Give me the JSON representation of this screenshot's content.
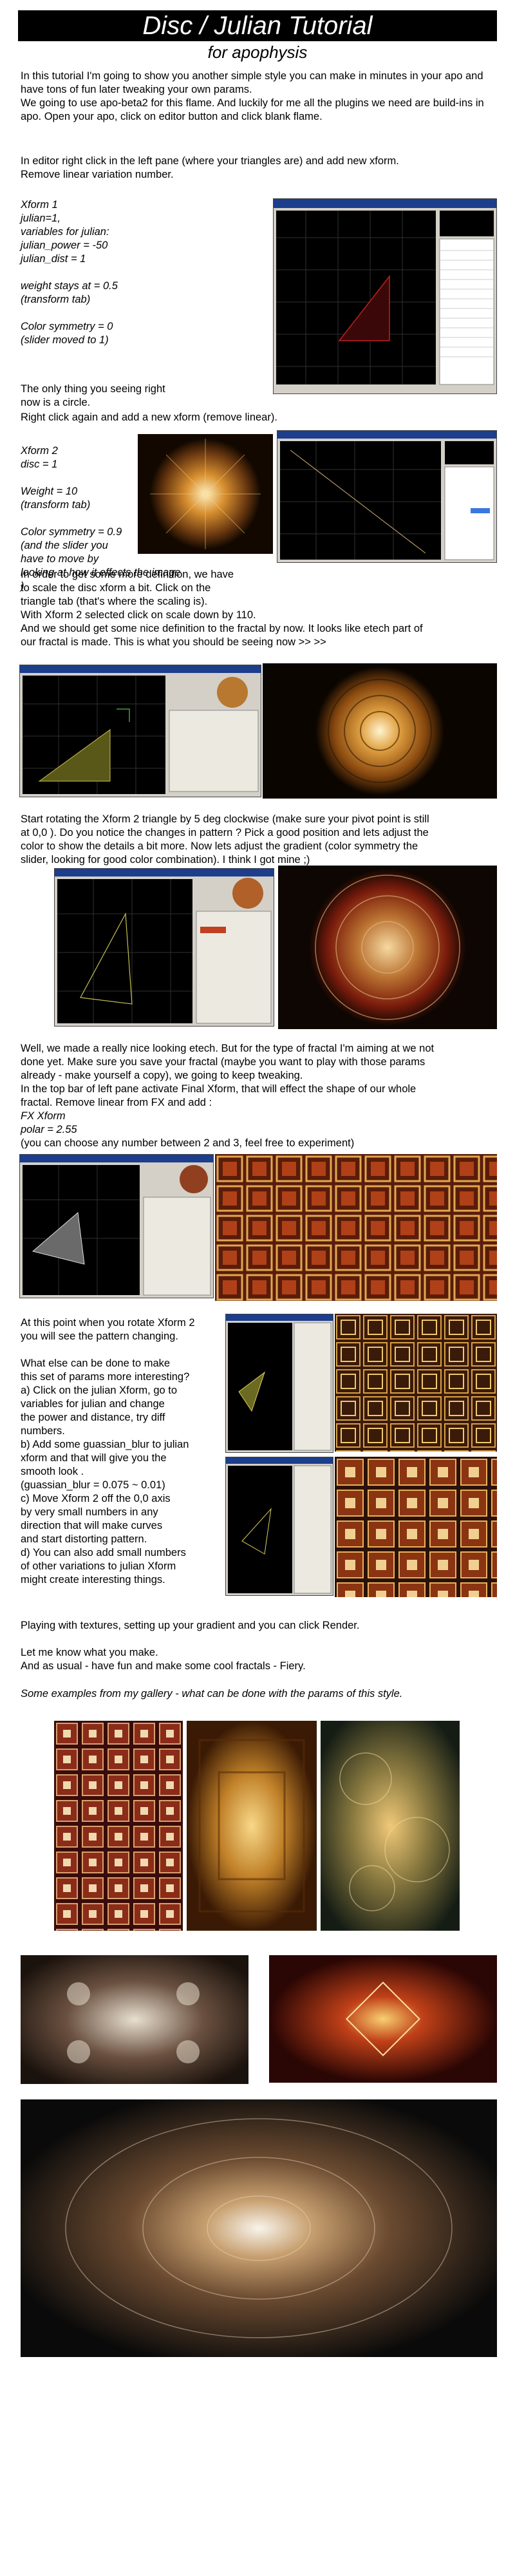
{
  "header": {
    "title": "Disc / Julian Tutorial",
    "subtitle": "for apophysis"
  },
  "intro": "In this tutorial I'm going to show you another simple style you can make in minutes in your apo and have tons of fun later tweaking your own params.\nWe going to use apo-beta2 for this flame. And luckily for me all the plugins we need are build-ins in apo. Open your apo, click on editor button and click blank flame.",
  "step1": {
    "text": "In editor right click in the left pane (where your triangles are) and add new xform.\nRemove linear variation number.",
    "xform1": "Xform 1\njulian=1,\nvariables  for julian:\njulian_power = -50\njulian_dist = 1\n\nweight stays at = 0.5\n(transform tab)\n\nColor symmetry = 0\n(slider moved to 1)",
    "circle_note": "The only thing you seeing right\nnow is a circle."
  },
  "step2": {
    "text": "Right click again and add a new xform (remove linear).",
    "xform2": "Xform 2\ndisc = 1\n\nWeight = 10\n(transform tab)\n\nColor symmetry = 0.9\n(and the slider you\nhave to move by\nlooking at how it effects the image )"
  },
  "step3": {
    "text": "In order to get some more definition, we have\nto scale the disc xform a bit. Click on the\ntriangle tab (that's where the scaling is).\nWith Xform 2 selected click on scale down by 110.\nAnd we should get some nice  definition to the fractal by now.  It looks like etech part of\nour fractal is made. This is what you should be seeing now >>  >>"
  },
  "step4": {
    "text": "Start rotating the Xform 2 triangle by 5 deg clockwise (make sure your pivot point is still\nat 0,0 ).  Do you notice the changes in pattern ? Pick a good position and lets adjust the\ncolor to show the details a bit more. Now lets adjust the gradient (color symmetry the\nslider, looking for good color combination). I think I got mine ;)"
  },
  "step5": {
    "text": "Well, we made a really nice looking etech. But for the type of fractal I'm aiming at we not\ndone yet. Make sure you save your fractal (maybe you want to play with those params\nalready - make yourself a copy), we going to keep tweaking.\nIn the top bar of left pane activate Final Xform, that will effect the shape of our whole\nfractal. Remove linear from FX and add :",
    "fx": "FX Xform\npolar = 2.55",
    "fx_note": "(you can choose any number between 2 and 3, feel free to experiment)"
  },
  "step6": {
    "text": "At this point when you rotate Xform 2\nyou will see the pattern changing.\n\nWhat else can be done to make\nthis set of params more interesting?\na) Click on the julian Xform, go to\n    variables for julian and  change\n    the power and distance, try diff\n    numbers.\nb) Add some guassian_blur to julian\n    xform and that will give you the\n    smooth look .\n    (guassian_blur = 0.075 ~ 0.01)\nc) Move Xform 2 off the 0,0 axis\n    by very small numbers in any\n    direction that will make curves\n    and start distorting pattern.\nd) You can also add small numbers\n    of other variations to julian Xform\n    might create interesting things."
  },
  "outro": "Playing with textures, setting up your gradient and you can click Render.\n\nLet me know what you make.\nAnd as usual - have fun and make some cool fractals  -  Fiery.",
  "gallery_caption": "Some examples from my gallery - what can be done with the params of this style."
}
